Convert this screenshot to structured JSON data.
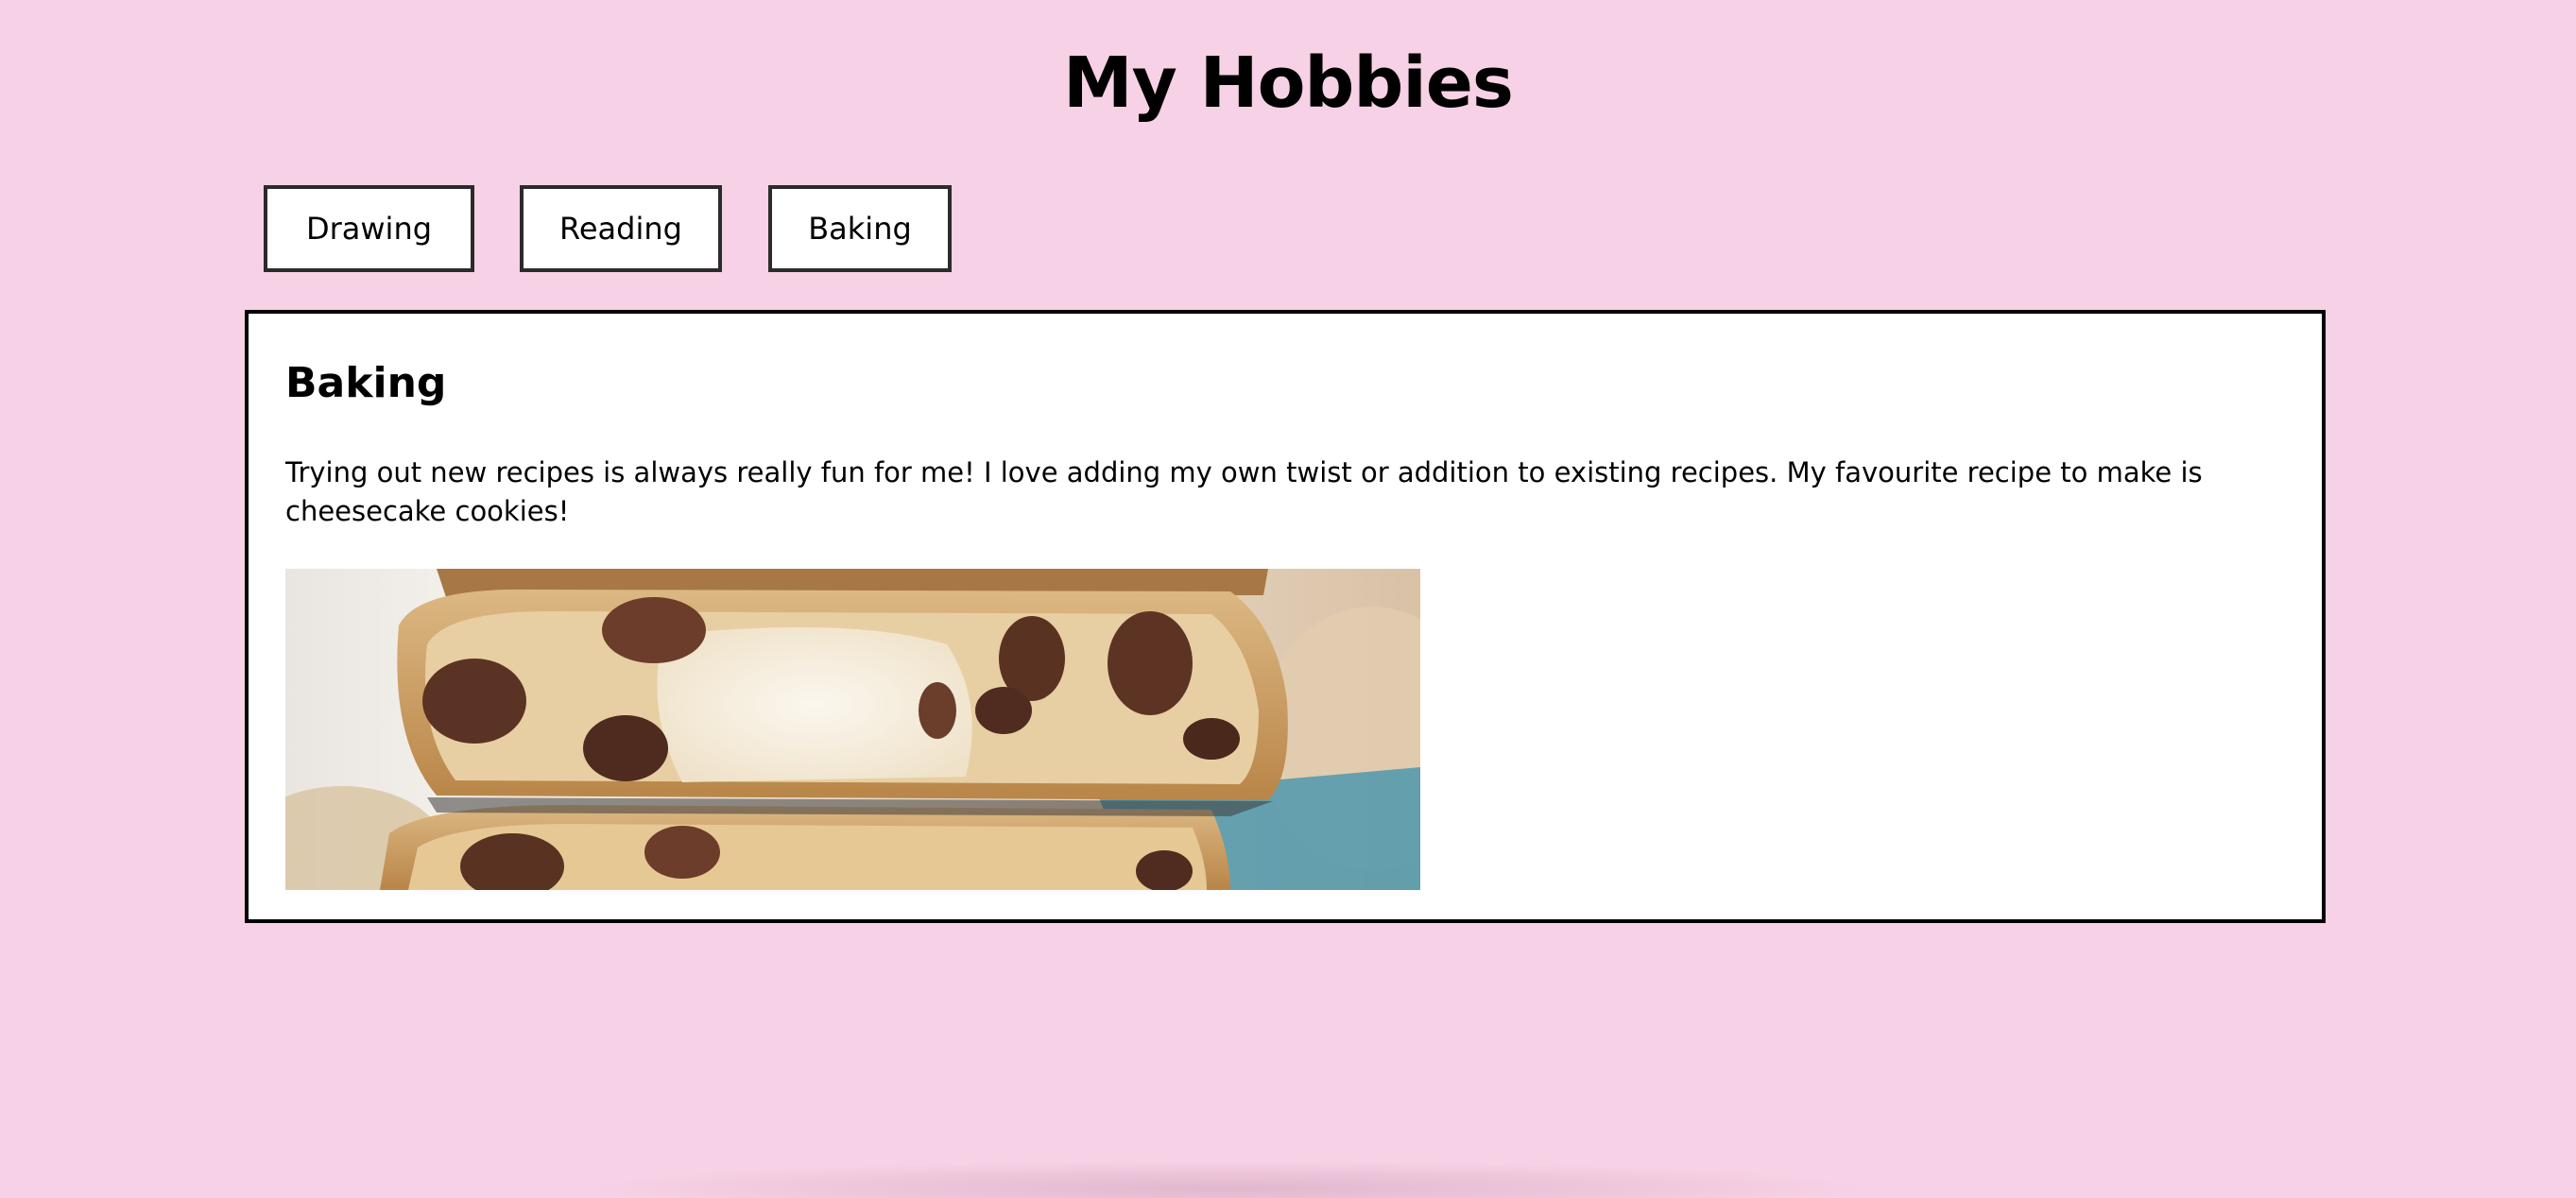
{
  "page": {
    "title": "My Hobbies"
  },
  "tabs": [
    {
      "label": "Drawing"
    },
    {
      "label": "Reading"
    },
    {
      "label": "Baking"
    }
  ],
  "active_panel": {
    "heading": "Baking",
    "description": "Trying out new recipes is always really fun for me! I love adding my own twist or addition to existing recipes. My favourite recipe to make is cheesecake cookies!",
    "image_subject": "stacked chocolate chip cheesecake cookies"
  },
  "colors": {
    "background": "#f7d1e5",
    "panel": "#ffffff",
    "border": "#000000"
  }
}
